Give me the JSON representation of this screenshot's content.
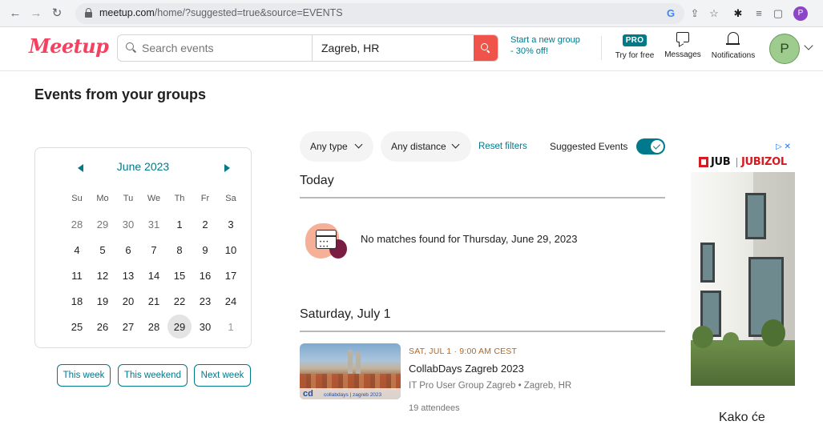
{
  "browser": {
    "url_host": "meetup.com",
    "url_path": "/home/?suggested=true&source=EVENTS",
    "profile_initial": "P"
  },
  "header": {
    "logo": "Meetup",
    "search_placeholder": "Search events",
    "location": "Zagreb, HR",
    "new_group_line1": "Start a new group",
    "new_group_line2": "- 30% off!",
    "pro_badge": "PRO",
    "pro_label": "Try for free",
    "messages_label": "Messages",
    "notifications_label": "Notifications",
    "avatar_initial": "P"
  },
  "page": {
    "title": "Events from your groups"
  },
  "calendar": {
    "month": "June 2023",
    "weekdays": [
      "Su",
      "Mo",
      "Tu",
      "We",
      "Th",
      "Fr",
      "Sa"
    ],
    "weeks": [
      [
        "28",
        "29",
        "30",
        "31",
        "1",
        "2",
        "3"
      ],
      [
        "4",
        "5",
        "6",
        "7",
        "8",
        "9",
        "10"
      ],
      [
        "11",
        "12",
        "13",
        "14",
        "15",
        "16",
        "17"
      ],
      [
        "18",
        "19",
        "20",
        "21",
        "22",
        "23",
        "24"
      ],
      [
        "25",
        "26",
        "27",
        "28",
        "29",
        "30",
        "1"
      ]
    ],
    "selected_day": "29"
  },
  "quick_filters": {
    "this_week": "This week",
    "this_weekend": "This weekend",
    "next_week": "Next week"
  },
  "filters": {
    "type": "Any type",
    "distance": "Any distance",
    "reset": "Reset filters",
    "suggested_label": "Suggested Events",
    "suggested_on": true
  },
  "today": {
    "heading": "Today",
    "empty_message": "No matches found for Thursday, June 29, 2023"
  },
  "saturday": {
    "heading": "Saturday, July 1",
    "event": {
      "date": "SAT, JUL 1 · 9:00 AM CEST",
      "title": "CollabDays Zagreb 2023",
      "group": "IT Pro User Group Zagreb • Zagreb, HR",
      "attendees": "19 attendees",
      "thumb_logo": "cd",
      "thumb_text": "collabdays | zagreb 2023"
    }
  },
  "ad": {
    "brand": "JUB",
    "product": "JUBIZOL",
    "choices": "▷ ✕",
    "caption": "Kako će"
  },
  "colors": {
    "brand": "#f64060",
    "teal": "#00798a",
    "search_button": "#f0534a"
  }
}
